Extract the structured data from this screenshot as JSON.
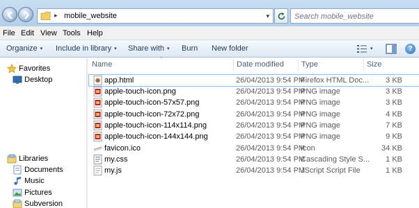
{
  "address": {
    "breadcrumb_separator": "▸",
    "breadcrumb": "mobile_website",
    "dropdown_glyph": "▾",
    "refresh_icon": "refresh-icon"
  },
  "search": {
    "placeholder": "Search mobile_website"
  },
  "menu": [
    "File",
    "Edit",
    "View",
    "Tools",
    "Help"
  ],
  "commands": {
    "organize": "Organize",
    "include_in_library": "Include in library",
    "share_with": "Share with",
    "burn": "Burn",
    "new_folder": "New folder",
    "caret": "▾",
    "help": "?"
  },
  "nav": {
    "favorites": "Favorites",
    "desktop": "Desktop",
    "libraries": "Libraries",
    "documents": "Documents",
    "music": "Music",
    "pictures": "Pictures",
    "subversion": "Subversion"
  },
  "columns": {
    "name": "Name",
    "date": "Date modified",
    "type": "Type",
    "size": "Size",
    "sort_glyph": "^"
  },
  "files": [
    {
      "name": "app.html",
      "date": "26/04/2013 9:54 PM",
      "type": "Firefox HTML Doc...",
      "size": "3 KB",
      "icon": "firefox-html-icon",
      "selected": true
    },
    {
      "name": "apple-touch-icon.png",
      "date": "26/04/2013 9:54 PM",
      "type": "PNG image",
      "size": "3 KB",
      "icon": "png-image-icon"
    },
    {
      "name": "apple-touch-icon-57x57.png",
      "date": "26/04/2013 9:54 PM",
      "type": "PNG image",
      "size": "3 KB",
      "icon": "png-image-icon"
    },
    {
      "name": "apple-touch-icon-72x72.png",
      "date": "26/04/2013 9:54 PM",
      "type": "PNG image",
      "size": "4 KB",
      "icon": "png-image-icon"
    },
    {
      "name": "apple-touch-icon-114x114.png",
      "date": "26/04/2013 9:54 PM",
      "type": "PNG image",
      "size": "7 KB",
      "icon": "png-image-icon"
    },
    {
      "name": "apple-touch-icon-144x144.png",
      "date": "26/04/2013 9:54 PM",
      "type": "PNG image",
      "size": "9 KB",
      "icon": "png-image-icon"
    },
    {
      "name": "favicon.ico",
      "date": "26/04/2013 9:54 PM",
      "type": "Icon",
      "size": "34 KB",
      "icon": "ico-file-icon"
    },
    {
      "name": "my.css",
      "date": "26/04/2013 9:54 PM",
      "type": "Cascading Style S...",
      "size": "1 KB",
      "icon": "css-file-icon"
    },
    {
      "name": "my.js",
      "date": "26/04/2013 9:54 PM",
      "type": "JScript Script File",
      "size": "1 KB",
      "icon": "js-file-icon"
    }
  ]
}
